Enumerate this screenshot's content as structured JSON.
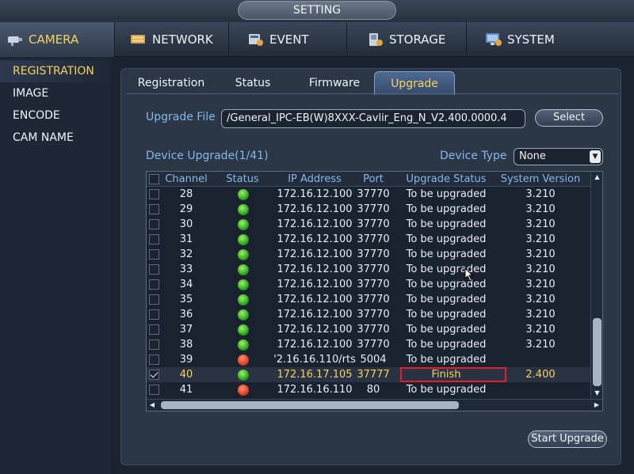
{
  "title": "SETTING",
  "topnav": [
    {
      "label": "CAMERA",
      "icon": "camera-icon",
      "active": true
    },
    {
      "label": "NETWORK",
      "icon": "network-icon",
      "active": false
    },
    {
      "label": "EVENT",
      "icon": "event-icon",
      "active": false
    },
    {
      "label": "STORAGE",
      "icon": "storage-icon",
      "active": false
    },
    {
      "label": "SYSTEM",
      "icon": "system-icon",
      "active": false
    }
  ],
  "sidebar": {
    "items": [
      {
        "label": "REGISTRATION",
        "active": true
      },
      {
        "label": "IMAGE",
        "active": false
      },
      {
        "label": "ENCODE",
        "active": false
      },
      {
        "label": "CAM NAME",
        "active": false
      }
    ]
  },
  "subtabs": [
    {
      "label": "Registration",
      "active": false
    },
    {
      "label": "Status",
      "active": false
    },
    {
      "label": "Firmware",
      "active": false
    },
    {
      "label": "Upgrade",
      "active": true
    }
  ],
  "upgrade": {
    "file_label": "Upgrade File",
    "file_value": "/General_IPC-EB(W)8XXX-Cavlir_Eng_N_V2.400.0000.4",
    "select_label": "Select",
    "device_upgrade_label": "Device Upgrade(1/41)",
    "device_type_label": "Device Type",
    "device_type_value": "None",
    "start_upgrade_label": "Start Upgrade"
  },
  "table": {
    "headers": [
      "Channel",
      "Status",
      "IP Address",
      "Port",
      "Upgrade Status",
      "System Version"
    ],
    "rows": [
      {
        "checked": false,
        "channel": "28",
        "status": "green",
        "ip": "172.16.12.100",
        "port": "37770",
        "upgrade_status": "To be upgraded",
        "version": "3.210",
        "selected": false
      },
      {
        "checked": false,
        "channel": "29",
        "status": "green",
        "ip": "172.16.12.100",
        "port": "37770",
        "upgrade_status": "To be upgraded",
        "version": "3.210",
        "selected": false
      },
      {
        "checked": false,
        "channel": "30",
        "status": "green",
        "ip": "172.16.12.100",
        "port": "37770",
        "upgrade_status": "To be upgraded",
        "version": "3.210",
        "selected": false
      },
      {
        "checked": false,
        "channel": "31",
        "status": "green",
        "ip": "172.16.12.100",
        "port": "37770",
        "upgrade_status": "To be upgraded",
        "version": "3.210",
        "selected": false
      },
      {
        "checked": false,
        "channel": "32",
        "status": "green",
        "ip": "172.16.12.100",
        "port": "37770",
        "upgrade_status": "To be upgraded",
        "version": "3.210",
        "selected": false
      },
      {
        "checked": false,
        "channel": "33",
        "status": "green",
        "ip": "172.16.12.100",
        "port": "37770",
        "upgrade_status": "To be upgraded",
        "version": "3.210",
        "selected": false
      },
      {
        "checked": false,
        "channel": "34",
        "status": "green",
        "ip": "172.16.12.100",
        "port": "37770",
        "upgrade_status": "To be upgraded",
        "version": "3.210",
        "selected": false
      },
      {
        "checked": false,
        "channel": "35",
        "status": "green",
        "ip": "172.16.12.100",
        "port": "37770",
        "upgrade_status": "To be upgraded",
        "version": "3.210",
        "selected": false
      },
      {
        "checked": false,
        "channel": "36",
        "status": "green",
        "ip": "172.16.12.100",
        "port": "37770",
        "upgrade_status": "To be upgraded",
        "version": "3.210",
        "selected": false
      },
      {
        "checked": false,
        "channel": "37",
        "status": "green",
        "ip": "172.16.12.100",
        "port": "37770",
        "upgrade_status": "To be upgraded",
        "version": "3.210",
        "selected": false
      },
      {
        "checked": false,
        "channel": "38",
        "status": "green",
        "ip": "172.16.12.100",
        "port": "37770",
        "upgrade_status": "To be upgraded",
        "version": "3.210",
        "selected": false
      },
      {
        "checked": false,
        "channel": "39",
        "status": "red",
        "ip": "'2.16.16.110/rts",
        "port": "5004",
        "upgrade_status": "To be upgraded",
        "version": "",
        "selected": false
      },
      {
        "checked": true,
        "channel": "40",
        "status": "green",
        "ip": "172.16.17.105",
        "port": "37777",
        "upgrade_status": "Finish",
        "version": "2.400",
        "selected": true
      },
      {
        "checked": false,
        "channel": "41",
        "status": "red",
        "ip": "172.16.16.110",
        "port": "80",
        "upgrade_status": "To be upgraded",
        "version": "",
        "selected": false
      }
    ]
  },
  "colors": {
    "accent_yellow": "#f6d35a",
    "label_blue": "#86b8ea",
    "highlight_red": "#e0202a"
  }
}
